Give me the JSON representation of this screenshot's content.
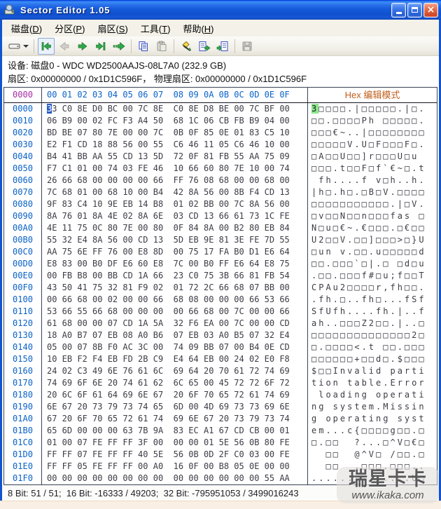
{
  "window": {
    "title": "Sector Editor 1.05"
  },
  "titlebar": {
    "buttons": [
      "minimize",
      "maximize",
      "close"
    ]
  },
  "menubar": {
    "items": [
      {
        "name": "disk",
        "label": "磁盘",
        "mnemonic": "D"
      },
      {
        "name": "partition",
        "label": "分区",
        "mnemonic": "P"
      },
      {
        "name": "sector",
        "label": "扇区",
        "mnemonic": "S"
      },
      {
        "name": "tools",
        "label": "工具",
        "mnemonic": "T"
      },
      {
        "name": "help",
        "label": "帮助",
        "mnemonic": "H"
      }
    ]
  },
  "toolbar": {
    "icons": [
      "disk-selector",
      "first-sector",
      "prev-sector",
      "next-sector",
      "last-sector",
      "goto-sector",
      "copy",
      "paste",
      "fill",
      "export",
      "import",
      "save"
    ],
    "disabled": [
      "prev-sector",
      "paste",
      "save"
    ]
  },
  "info": {
    "device_line": "设备: 磁盘0 - WDC WD2500AAJS-08L7A0 (232.9 GB)",
    "sector_line": "扇区: 0x00000000 / 0x1D1C596F， 物理扇区: 0x00000000 / 0x1D1C596F"
  },
  "editor": {
    "header": {
      "addr": "0000",
      "cols": "00 01 02 03 04 05 06 07  08 09 0A 0B 0C 0D 0E 0F",
      "mode_label": "Hex 编辑模式"
    },
    "selection": {
      "row_index": 0,
      "hex_selected_color": "#2A5BC8",
      "ascii_selected_color": "#8DE68D"
    },
    "rows": [
      {
        "addr": "0000",
        "hex": "33 C0 8E D0 BC 00 7C 8E  C0 8E D8 BE 00 7C BF 00",
        "ascii": "3□□□□.|□□□□□.|□."
      },
      {
        "addr": "0010",
        "hex": "06 B9 00 02 FC F3 A4 50  68 1C 06 CB FB B9 04 00",
        "ascii": "□□.□□□□Ph □□□□□."
      },
      {
        "addr": "0020",
        "hex": "BD BE 07 80 7E 00 00 7C  0B 0F 85 0E 01 83 C5 10",
        "ascii": "□□□€~..|□□□□□□□□"
      },
      {
        "addr": "0030",
        "hex": "E2 F1 CD 18 88 56 00 55  C6 46 11 05 C6 46 10 00",
        "ascii": "□□□□□V.U□F□□□F□."
      },
      {
        "addr": "0040",
        "hex": "B4 41 BB AA 55 CD 13 5D  72 0F 81 FB 55 AA 75 09",
        "ascii": "□A□□U□□]r□□□U□u "
      },
      {
        "addr": "0050",
        "hex": "F7 C1 01 00 74 03 FE 46  10 66 60 80 7E 10 00 74",
        "ascii": "□□□.t□□F□f`€~□.t"
      },
      {
        "addr": "0060",
        "hex": "26 66 68 00 00 00 00 66  FF 76 08 68 00 00 68 00",
        "ascii": " fh....f v□h..h."
      },
      {
        "addr": "0070",
        "hex": "7C 68 01 00 68 10 00 B4  42 8A 56 00 8B F4 CD 13",
        "ascii": "|h□.h□.□B□V.□□□□"
      },
      {
        "addr": "0080",
        "hex": "9F 83 C4 10 9E EB 14 B8  01 02 BB 00 7C 8A 56 00",
        "ascii": "□□□□□□□□□□□.|□V."
      },
      {
        "addr": "0090",
        "hex": "8A 76 01 8A 4E 02 8A 6E  03 CD 13 66 61 73 1C FE",
        "ascii": "□v□□N□□n□□□fas □"
      },
      {
        "addr": "00A0",
        "hex": "4E 11 75 0C 80 7E 00 80  0F 84 8A 00 B2 80 EB 84",
        "ascii": "N□u□€~.€□□□.□€□□"
      },
      {
        "addr": "00B0",
        "hex": "55 32 E4 8A 56 00 CD 13  5D EB 9E 81 3E FE 7D 55",
        "ascii": "U2□□V.□□]□□□>□}U"
      },
      {
        "addr": "00C0",
        "hex": "AA 75 6E FF 76 00 E8 8D  00 75 17 FA B0 D1 E6 64",
        "ascii": "□un v.□□.u□□□□□d"
      },
      {
        "addr": "00D0",
        "hex": "E8 83 00 B0 DF E6 60 E8  7C 00 B0 FF E6 64 E8 75",
        "ascii": "□□.□□□`□|.□ □d□u"
      },
      {
        "addr": "00E0",
        "hex": "00 FB B8 00 BB CD 1A 66  23 C0 75 3B 66 81 FB 54",
        "ascii": ".□□.□□□f#□u;f□□T"
      },
      {
        "addr": "00F0",
        "hex": "43 50 41 75 32 81 F9 02  01 72 2C 66 68 07 BB 00",
        "ascii": "CPAu2□□□□r,fh□□."
      },
      {
        "addr": "0100",
        "hex": "00 66 68 00 02 00 00 66  68 08 00 00 00 66 53 66",
        "ascii": ".fh.□..fh□...fSf"
      },
      {
        "addr": "0110",
        "hex": "53 66 55 66 68 00 00 00  00 66 68 00 7C 00 00 66",
        "ascii": "SfUfh....fh.|..f"
      },
      {
        "addr": "0120",
        "hex": "61 68 00 00 07 CD 1A 5A  32 F6 EA 00 7C 00 00 CD",
        "ascii": "ah..□□□Z2□□.|..□"
      },
      {
        "addr": "0130",
        "hex": "18 A0 B7 07 EB 08 A0 B6  07 EB 03 A0 B5 07 32 E4",
        "ascii": "□□□□□□□□□□□□□□2□"
      },
      {
        "addr": "0140",
        "hex": "05 00 07 8B F0 AC 3C 00  74 09 BB 07 00 B4 0E CD",
        "ascii": "□.□□□□<.t □□.□□□"
      },
      {
        "addr": "0150",
        "hex": "10 EB F2 F4 EB FD 2B C9  E4 64 EB 00 24 02 E0 F8",
        "ascii": "□□□□□□+□□d□.$□□□"
      },
      {
        "addr": "0160",
        "hex": "24 02 C3 49 6E 76 61 6C  69 64 20 70 61 72 74 69",
        "ascii": "$□□Invalid parti"
      },
      {
        "addr": "0170",
        "hex": "74 69 6F 6E 20 74 61 62  6C 65 00 45 72 72 6F 72",
        "ascii": "tion table.Error"
      },
      {
        "addr": "0180",
        "hex": "20 6C 6F 61 64 69 6E 67  20 6F 70 65 72 61 74 69",
        "ascii": " loading operati"
      },
      {
        "addr": "0190",
        "hex": "6E 67 20 73 79 73 74 65  6D 00 4D 69 73 73 69 6E",
        "ascii": "ng system.Missin"
      },
      {
        "addr": "01A0",
        "hex": "67 20 6F 70 65 72 61 74  69 6E 67 20 73 79 73 74",
        "ascii": "g operating syst"
      },
      {
        "addr": "01B0",
        "hex": "65 6D 00 00 00 63 7B 9A  83 EC A1 67 CD CB 00 01",
        "ascii": "em...c{□□□□g□□.□"
      },
      {
        "addr": "01C0",
        "hex": "01 00 07 FE FF FF 3F 00  00 00 01 5E 56 0B 80 FE",
        "ascii": "□.□□  ?...□^V□€□"
      },
      {
        "addr": "01D0",
        "hex": "FF FF 07 FE FF FF 40 5E  56 0B 0D 2F C0 03 00 FE",
        "ascii": "  □□  @^V□ /□□.□"
      },
      {
        "addr": "01E0",
        "hex": "FF FF 05 FE FF FF 00 A0  16 0F 00 B8 05 0E 00 00",
        "ascii": "  □□  .□□□.□□□.."
      },
      {
        "addr": "01F0",
        "hex": "00 00 00 00 00 00 00 00  00 00 00 00 00 00 55 AA",
        "ascii": "..............U□"
      }
    ]
  },
  "statusbar": {
    "text": "8 Bit: 51 / 51;  16 Bit: -16333 / 49203;  32 Bit: -795951053 / 3499016243"
  },
  "watermark": {
    "brand": "瑞星卡卡",
    "url": "www.ikaka.com"
  },
  "colors": {
    "titlebar_blue": "#1254D0",
    "address_blue": "#0A62C8",
    "header_magenta": "#A62CA6",
    "mode_label_orange": "#C0601E",
    "hex_text": "#3C3C46",
    "selection_blue": "#2A5BC8",
    "selection_green": "#8DE68D",
    "grid_line": "#3A4254"
  }
}
